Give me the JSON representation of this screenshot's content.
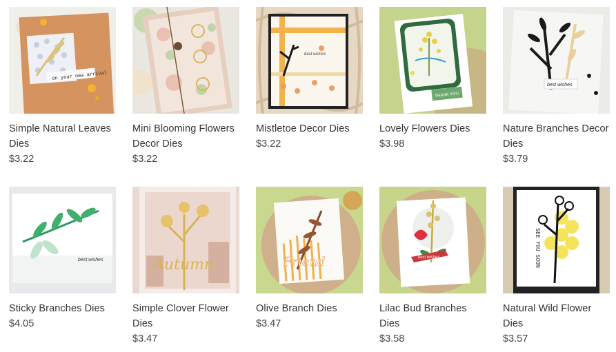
{
  "products": [
    {
      "title": "Simple Natural Leaves Dies",
      "price": "$3.22",
      "image": "card-simple-natural-leaves",
      "card_caption": "on your new arrival"
    },
    {
      "title": "Mini Blooming Flowers Decor Dies",
      "price": "$3.22",
      "image": "card-mini-blooming-flowers"
    },
    {
      "title": "Mistletoe Decor Dies",
      "price": "$3.22",
      "image": "card-mistletoe-decor",
      "card_caption": "best wishes"
    },
    {
      "title": "Lovely Flowers Dies",
      "price": "$3.98",
      "image": "card-lovely-flowers",
      "card_caption": "THANK YOU"
    },
    {
      "title": "Nature Branches Decor Dies",
      "price": "$3.79",
      "image": "card-nature-branches",
      "card_caption": "best wishes"
    },
    {
      "title": "Sticky Branches Dies",
      "price": "$4.05",
      "image": "card-sticky-branches",
      "card_caption": "best wishes"
    },
    {
      "title": "Simple Clover Flower Dies",
      "price": "$3.47",
      "image": "card-simple-clover-flower",
      "card_caption": "Autumn"
    },
    {
      "title": "Olive Branch Dies",
      "price": "$3.47",
      "image": "card-olive-branch",
      "card_caption": "Friend"
    },
    {
      "title": "Lilac Bud Branches Dies",
      "price": "$3.58",
      "image": "card-lilac-bud-branches",
      "card_caption": "best wishes"
    },
    {
      "title": "Natural Wild Flower Dies",
      "price": "$3.57",
      "image": "card-natural-wild-flower",
      "card_caption": "SEE YOU SOON"
    }
  ]
}
